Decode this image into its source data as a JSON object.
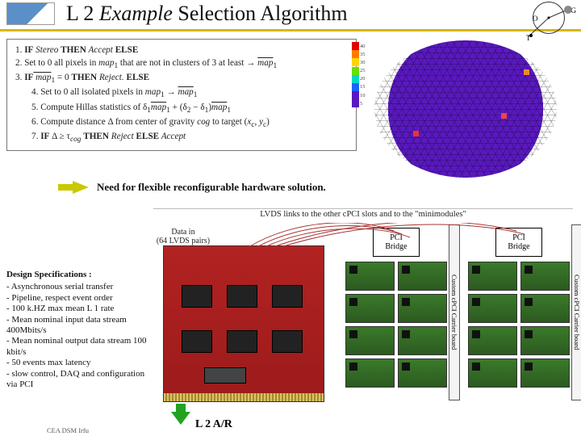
{
  "header": {
    "titleA": "L 2 ",
    "titleB": "Example",
    "titleC": " Selection Algorithm"
  },
  "algo": {
    "l1a": "1. ",
    "l1b": "IF",
    "l1c": " Stereo ",
    "l1d": "THEN",
    "l1e": " Accept ",
    "l1f": "ELSE",
    "l2a": "2. Set to 0 all pixels in ",
    "l2b": "map",
    "l2sub1": "1",
    "l2c": " that are not in clusters of 3 at least → ",
    "l2d": "map",
    "l2sub2": "1",
    "l3a": "3. ",
    "l3b": "IF",
    "l3c": " map",
    "l3sub": "1",
    "l3d": " = 0 ",
    "l3e": "THEN",
    "l3f": " Reject. ",
    "l3g": "ELSE",
    "l4a": "4. Set to 0 all isolated pixels in ",
    "l4b": "map",
    "l4sub1": "1",
    "l4c": " → ",
    "l4d": "map",
    "l4sub2": "1",
    "l5a": "5. Compute Hillas statistics of δ",
    "l5sub1": "1",
    "l5b": "map",
    "l5sub2": "1",
    "l5c": " + (δ",
    "l5sub3": "2",
    "l5d": " − δ",
    "l5sub4": "1",
    "l5e": ")",
    "l5f": "map",
    "l5sub5": "1",
    "l6a": "6. Compute distance Δ from center of gravity ",
    "l6b": "cog",
    "l6c": " to target (",
    "l6d": "x",
    "l6sub1": "c",
    "l6e": ", ",
    "l6f": "y",
    "l6sub2": "c",
    "l6g": ")",
    "l7a": "7. ",
    "l7b": "IF",
    "l7c": " Δ ≥ τ",
    "l7sub": "cog",
    "l7d": " ",
    "l7e": "THEN",
    "l7f": " Reject ",
    "l7g": "ELSE",
    "l7h": " Accept"
  },
  "needText": "Need for flexible reconfigurable hardware solution.",
  "lvdsLabel": "LVDS links to the other cPCI slots and to the \"minimodules\"",
  "dataIn": {
    "l1": "Data in",
    "l2": "(64 LVDS pairs)"
  },
  "bridge": {
    "l1": "PCI",
    "l2": "Bridge"
  },
  "carrier": "Custom cPCI Carrier board",
  "l2ar": "L 2 A/R",
  "rayInset": {
    "o": "O",
    "g": "G",
    "t": "T"
  },
  "scale": [
    {
      "v": "40",
      "c": "#e00000"
    },
    {
      "v": "35",
      "c": "#ff7a00"
    },
    {
      "v": "30",
      "c": "#ffd400"
    },
    {
      "v": "25",
      "c": "#68e000"
    },
    {
      "v": "20",
      "c": "#00d9c5"
    },
    {
      "v": "15",
      "c": "#1e63ff"
    },
    {
      "v": "10",
      "c": "#5919bf"
    },
    {
      "v": "5",
      "c": "#5919bf"
    }
  ],
  "specs": {
    "hd": "Design Specifications :",
    "items": [
      " - Asynchronous serial transfer",
      "- Pipeline, respect event order",
      "- 100 k.HZ max mean L 1 rate",
      "- Mean nominal input data stream 400Mbits/s",
      "- Mean nominal output data stream 100 kbit/s",
      "- 50 events max latency",
      "- slow control, DAQ and configuration via PCI"
    ]
  },
  "footer": "CEA DSM Irfu"
}
